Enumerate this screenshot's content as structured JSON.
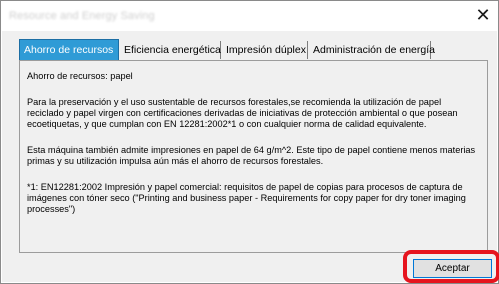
{
  "window": {
    "title": "Resource and Energy Saving",
    "close_glyph": "✕"
  },
  "tabs": [
    {
      "label": "Ahorro de recursos",
      "active": true
    },
    {
      "label": "Eficiencia energética",
      "active": false
    },
    {
      "label": "Impresión dúplex",
      "active": false
    },
    {
      "label": "Administración de energía",
      "active": false
    }
  ],
  "content": {
    "heading": "Ahorro de recursos: papel",
    "paragraph1": "Para la preservación y el uso sustentable de recursos forestales,se recomienda la utilización de papel reciclado y papel virgen con certificaciones derivadas de iniciativas de protección ambiental o que posean ecoetiquetas, y que cumplan con EN 12281:2002*1 o con cualquier norma de calidad equivalente.",
    "paragraph2": "Esta máquina también admite impresiones en papel de 64 g/m^2.  Este tipo de papel contiene menos materias primas y su utilización impulsa aún más el ahorro de recursos forestales.",
    "footnote": "*1: EN12281:2002 Impresión y papel comercial: requisitos de papel de copias para procesos de captura de imágenes con tóner seco (\"Printing and business paper - Requirements for copy paper for dry toner imaging processes\")"
  },
  "buttons": {
    "ok_label": "Aceptar"
  },
  "colors": {
    "active_tab": "#2f9bd6",
    "highlight": "#e6141e",
    "dialog_bg": "#f0f0f0"
  }
}
